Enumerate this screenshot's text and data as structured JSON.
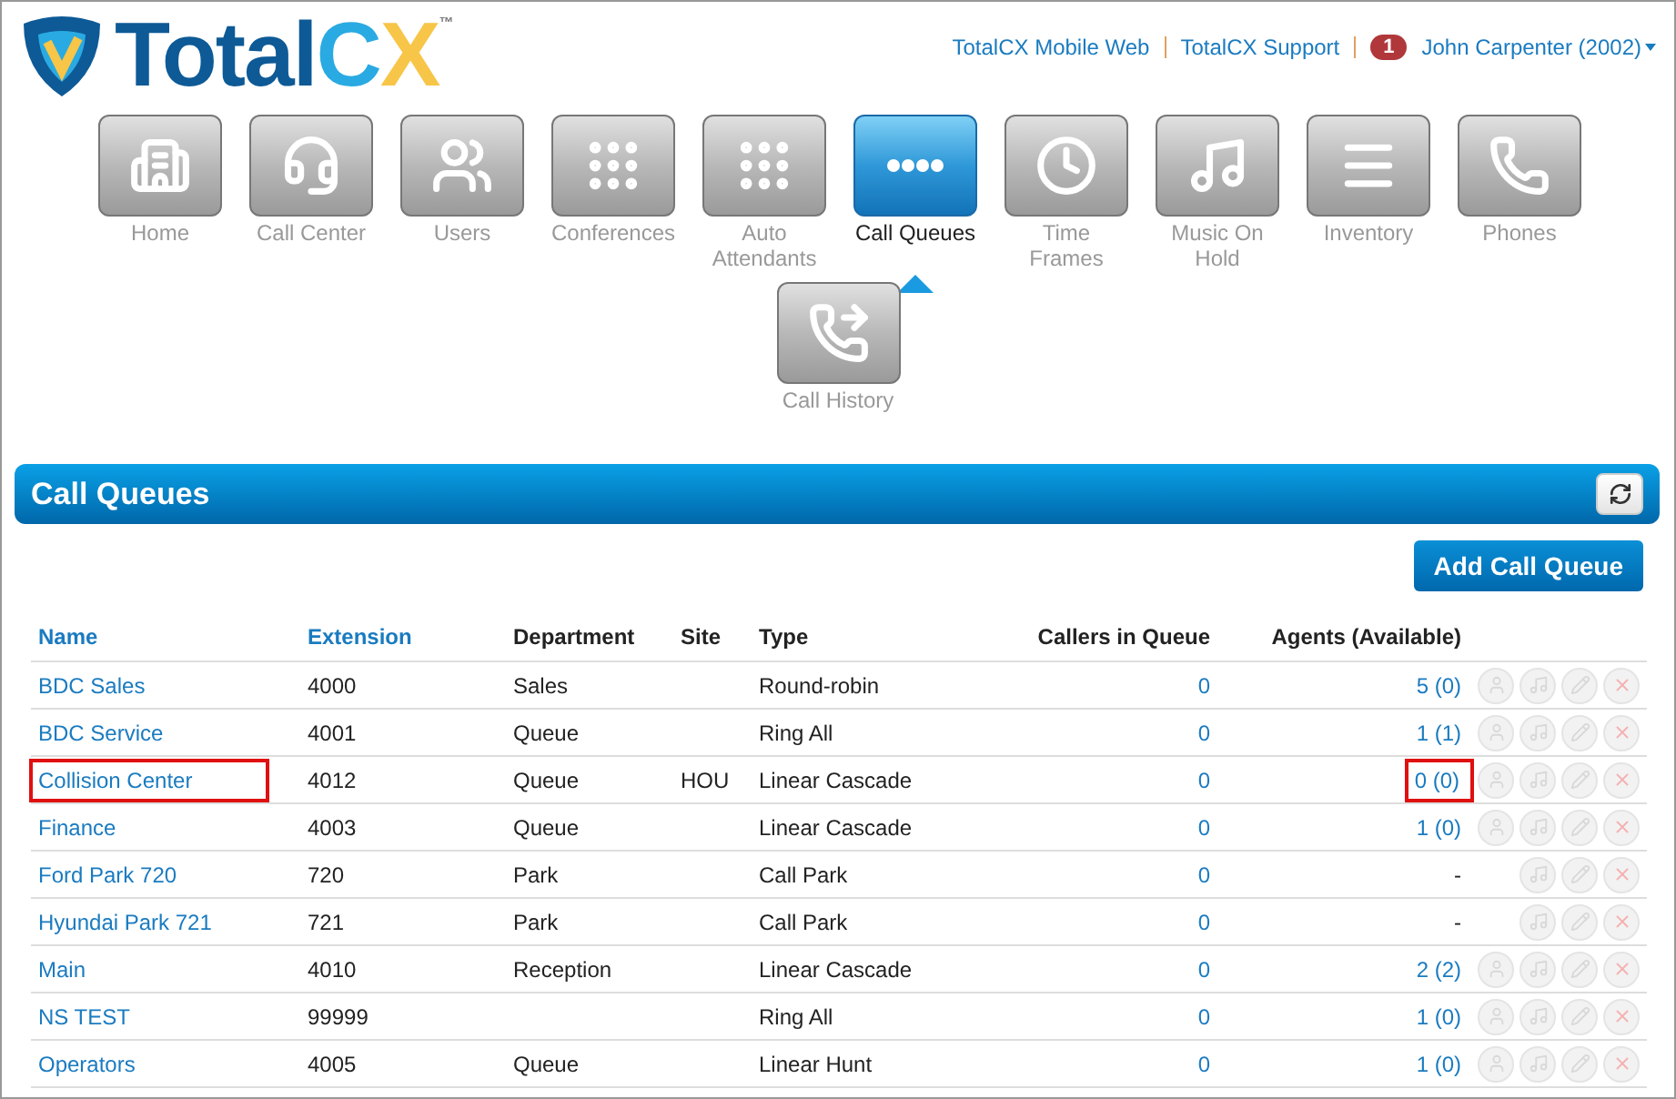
{
  "logo": {
    "parts": [
      {
        "text": "Total",
        "color": "#0d5a96"
      },
      {
        "text": "C",
        "color": "#2aaae2"
      },
      {
        "text": "X",
        "color": "#f7c548"
      }
    ],
    "trademark": "™"
  },
  "top_links": [
    "TotalCX Mobile Web",
    "TotalCX Support"
  ],
  "user": {
    "notifications": "1",
    "name": "John Carpenter (2002)"
  },
  "nav": [
    {
      "label": "Home",
      "selected": false
    },
    {
      "label": "Call Center",
      "selected": false
    },
    {
      "label": "Users",
      "selected": false
    },
    {
      "label": "Conferences",
      "selected": false
    },
    {
      "label": "Auto Attendants",
      "selected": false
    },
    {
      "label": "Call Queues",
      "selected": true
    },
    {
      "label": "Time Frames",
      "selected": false
    },
    {
      "label": "Music On Hold",
      "selected": false
    },
    {
      "label": "Inventory",
      "selected": false
    },
    {
      "label": "Phones",
      "selected": false
    },
    {
      "label": "Call History",
      "selected": false
    }
  ],
  "panel": {
    "title": "Call Queues",
    "add_button": "Add Call Queue"
  },
  "table": {
    "columns": [
      "Name",
      "Extension",
      "Department",
      "Site",
      "Type",
      "Callers in Queue",
      "Agents (Available)"
    ],
    "rows": [
      {
        "name": "BDC Sales",
        "extension": "4000",
        "department": "Sales",
        "site": "",
        "type": "Round-robin",
        "callers": "0",
        "agents": "5 (0)",
        "highlighted": false,
        "agents_action": true
      },
      {
        "name": "BDC Service",
        "extension": "4001",
        "department": "Queue",
        "site": "",
        "type": "Ring All",
        "callers": "0",
        "agents": "1 (1)",
        "highlighted": false,
        "agents_action": true
      },
      {
        "name": "Collision Center",
        "extension": "4012",
        "department": "Queue",
        "site": "HOU",
        "type": "Linear Cascade",
        "callers": "0",
        "agents": "0 (0)",
        "highlighted": true,
        "agents_action": true
      },
      {
        "name": "Finance",
        "extension": "4003",
        "department": "Queue",
        "site": "",
        "type": "Linear Cascade",
        "callers": "0",
        "agents": "1 (0)",
        "highlighted": false,
        "agents_action": true
      },
      {
        "name": "Ford Park 720",
        "extension": "720",
        "department": "Park",
        "site": "",
        "type": "Call Park",
        "callers": "0",
        "agents": "-",
        "highlighted": false,
        "agents_action": false
      },
      {
        "name": "Hyundai Park 721",
        "extension": "721",
        "department": "Park",
        "site": "",
        "type": "Call Park",
        "callers": "0",
        "agents": "-",
        "highlighted": false,
        "agents_action": false
      },
      {
        "name": "Main",
        "extension": "4010",
        "department": "Reception",
        "site": "",
        "type": "Linear Cascade",
        "callers": "0",
        "agents": "2 (2)",
        "highlighted": false,
        "agents_action": true
      },
      {
        "name": "NS TEST",
        "extension": "99999",
        "department": "",
        "site": "",
        "type": "Ring All",
        "callers": "0",
        "agents": "1 (0)",
        "highlighted": false,
        "agents_action": true
      },
      {
        "name": "Operators",
        "extension": "4005",
        "department": "Queue",
        "site": "",
        "type": "Linear Hunt",
        "callers": "0",
        "agents": "1 (0)",
        "highlighted": false,
        "agents_action": true
      }
    ]
  }
}
